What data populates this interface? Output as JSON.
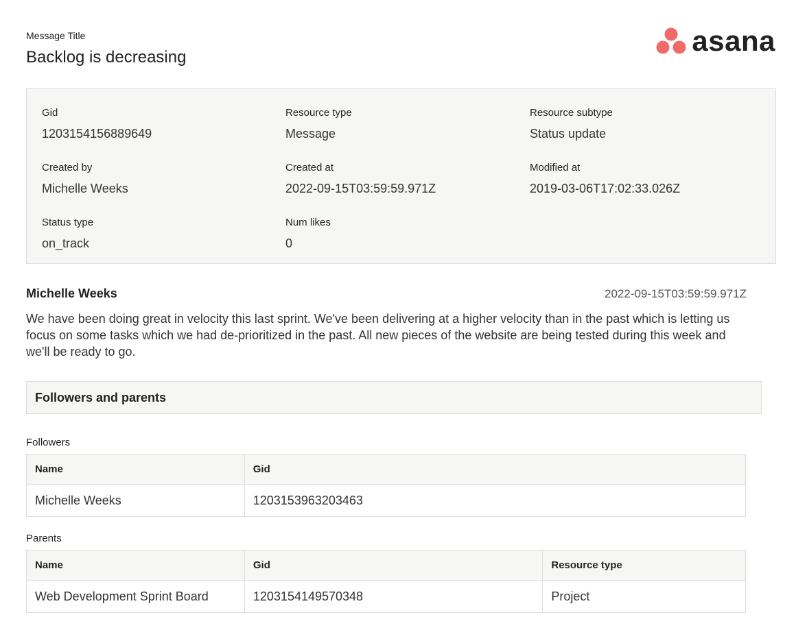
{
  "header": {
    "title_label": "Message Title",
    "title_value": "Backlog is decreasing",
    "logo_text": "asana",
    "logo_color": "#F06A6A"
  },
  "meta": {
    "gid": {
      "label": "Gid",
      "value": "1203154156889649"
    },
    "resource_type": {
      "label": "Resource type",
      "value": "Message"
    },
    "resource_subtype": {
      "label": "Resource subtype",
      "value": "Status update"
    },
    "created_by": {
      "label": "Created by",
      "value": "Michelle Weeks"
    },
    "created_at": {
      "label": "Created at",
      "value": "2022-09-15T03:59:59.971Z"
    },
    "modified_at": {
      "label": "Modified at",
      "value": "2019-03-06T17:02:33.026Z"
    },
    "status_type": {
      "label": "Status type",
      "value": "on_track"
    },
    "num_likes": {
      "label": "Num likes",
      "value": "0"
    }
  },
  "message": {
    "author": "Michelle Weeks",
    "date": "2022-09-15T03:59:59.971Z",
    "text": "We have been doing great in velocity this last sprint. We've been delivering at a higher velocity than in the past which is letting us focus on some tasks which we had de-prioritized in the past. All new pieces of the website are being tested during this week and we'll be ready to go."
  },
  "section": {
    "title": "Followers and parents"
  },
  "followers": {
    "caption": "Followers",
    "columns": [
      "Name",
      "Gid"
    ],
    "rows": [
      [
        "Michelle Weeks",
        "1203153963203463"
      ]
    ]
  },
  "parents": {
    "caption": "Parents",
    "columns": [
      "Name",
      "Gid",
      "Resource type"
    ],
    "rows": [
      [
        "Web Development Sprint Board",
        "1203154149570348",
        "Project"
      ]
    ]
  }
}
